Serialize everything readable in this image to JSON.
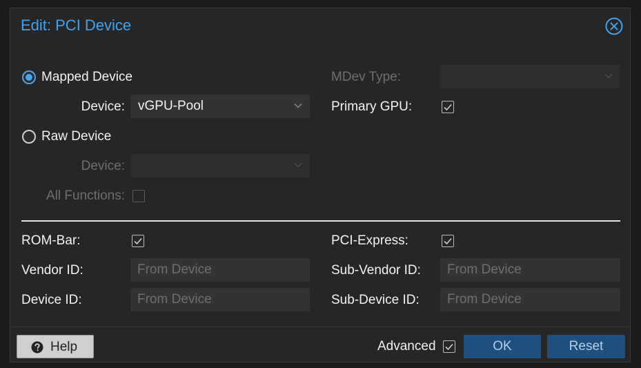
{
  "dialog": {
    "title": "Edit: PCI Device"
  },
  "form": {
    "mapped_device_label": "Mapped Device",
    "mapped_device_selected": true,
    "device_label": "Device:",
    "device_value": "vGPU-Pool",
    "raw_device_label": "Raw Device",
    "raw_device_selected": false,
    "raw_device_field_label": "Device:",
    "raw_device_value": "",
    "all_functions_label": "All Functions:",
    "all_functions_checked": false,
    "mdev_type_label": "MDev Type:",
    "mdev_type_value": "",
    "primary_gpu_label": "Primary GPU:",
    "primary_gpu_checked": true
  },
  "advanced": {
    "rom_bar_label": "ROM-Bar:",
    "rom_bar_checked": true,
    "pci_express_label": "PCI-Express:",
    "pci_express_checked": true,
    "vendor_id_label": "Vendor ID:",
    "vendor_id_placeholder": "From Device",
    "sub_vendor_id_label": "Sub-Vendor ID:",
    "sub_vendor_id_placeholder": "From Device",
    "device_id_label": "Device ID:",
    "device_id_placeholder": "From Device",
    "sub_device_id_label": "Sub-Device ID:",
    "sub_device_id_placeholder": "From Device"
  },
  "footer": {
    "help_label": "Help",
    "advanced_label": "Advanced",
    "advanced_checked": true,
    "ok_label": "OK",
    "reset_label": "Reset"
  },
  "colors": {
    "accent": "#3fa3f4",
    "primary_button": "#1f4f7f",
    "background": "#262626"
  },
  "icons": {
    "close": "close-circle-icon",
    "help": "question-circle-icon",
    "dropdown": "chevron-down-icon",
    "check": "check-icon"
  }
}
